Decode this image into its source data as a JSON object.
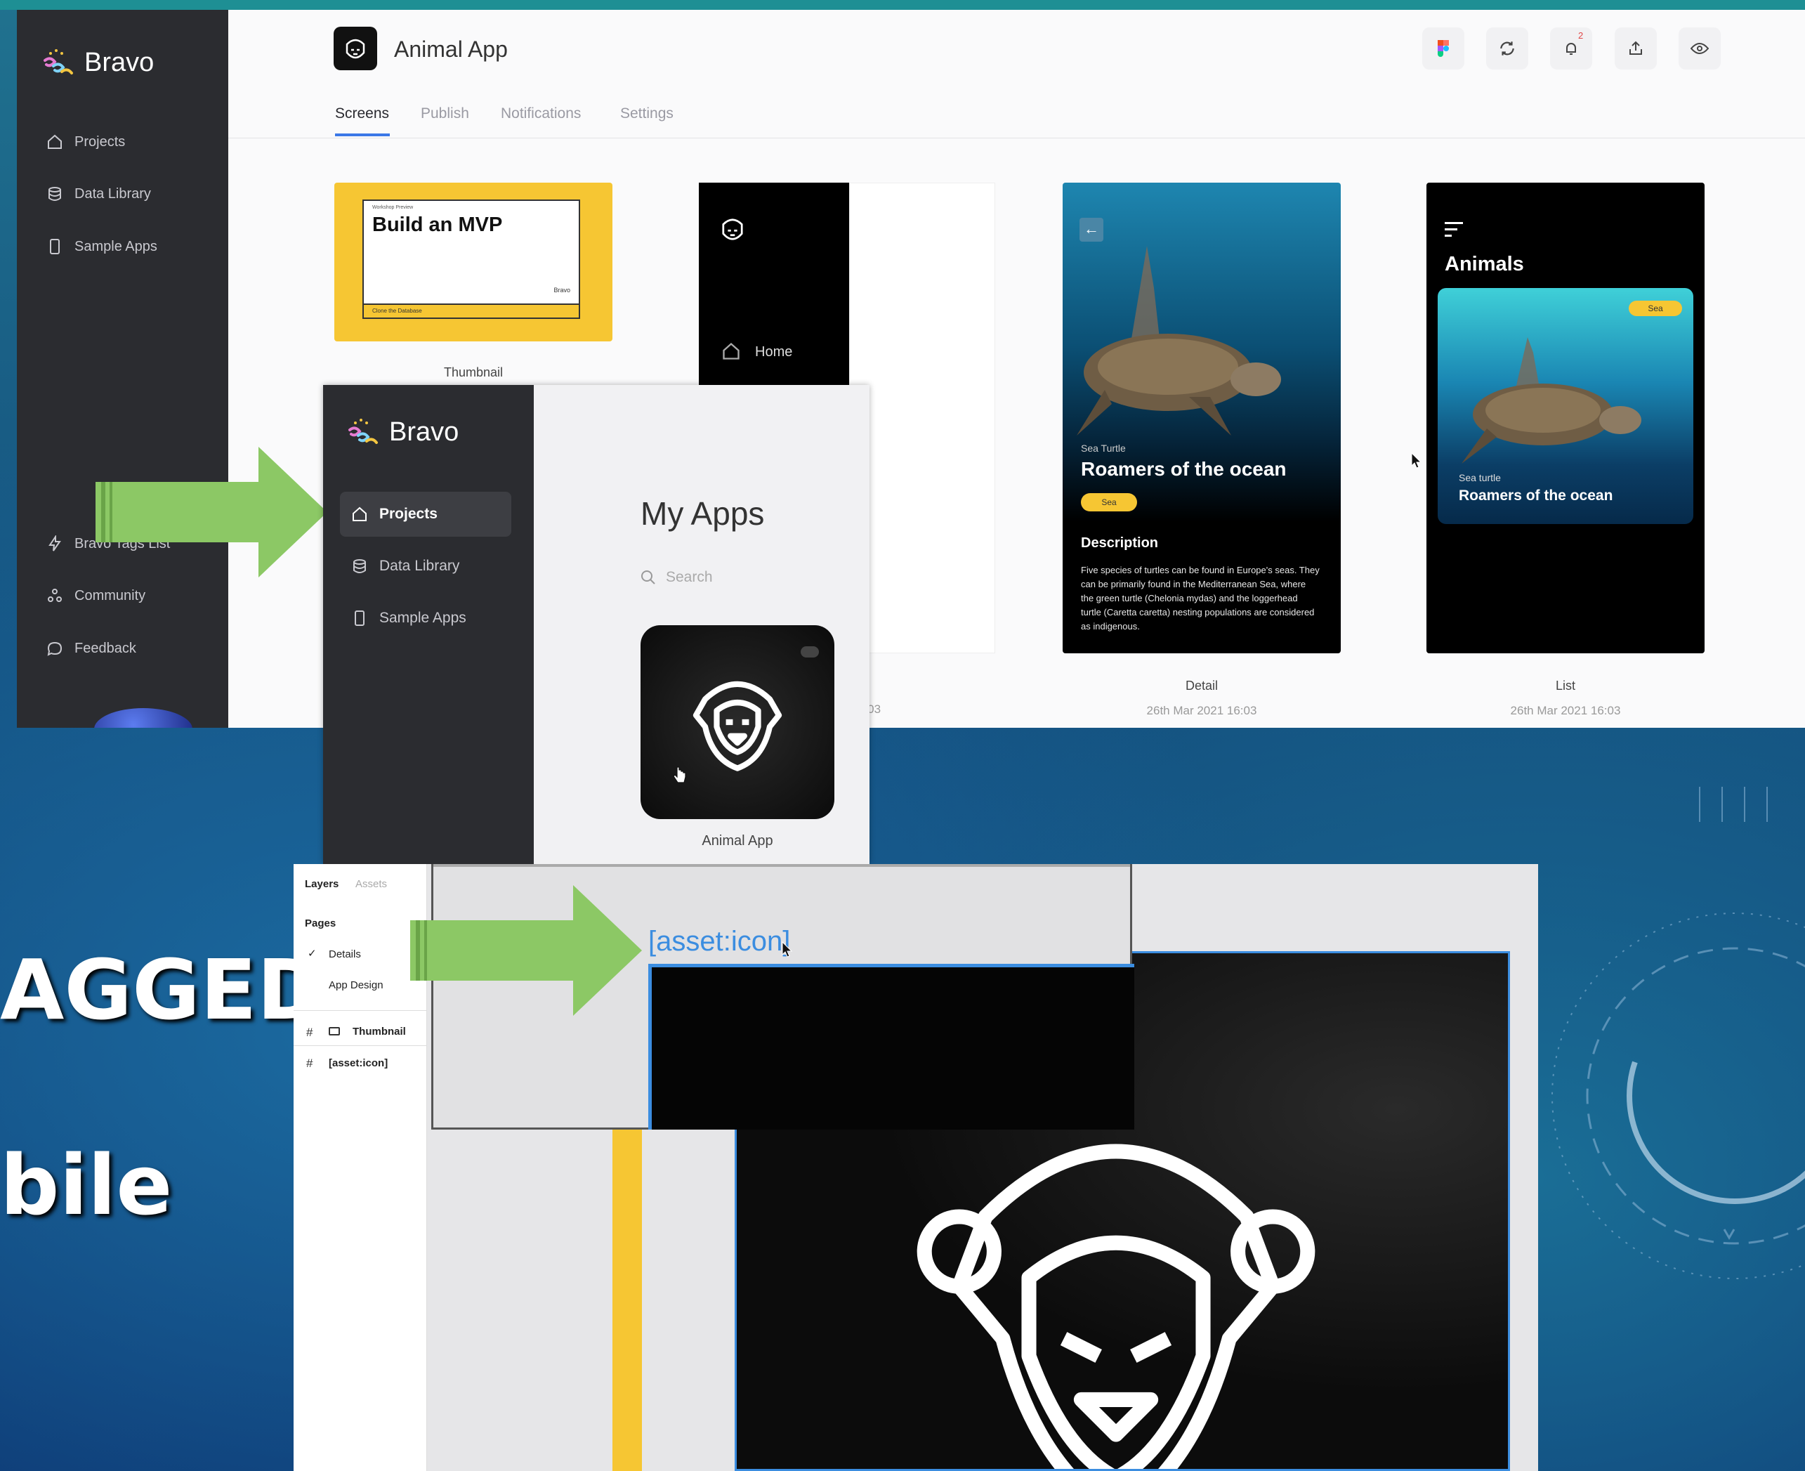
{
  "slide": {
    "partial_text_1": "AGGED",
    "partial_text_2": "bile"
  },
  "shot1": {
    "brand": "Bravo",
    "sidebar_items": [
      "Projects",
      "Data Library",
      "Sample Apps"
    ],
    "sidebar_bottom_items": [
      "Bravo Tags List",
      "Community",
      "Feedback"
    ],
    "app_title": "Animal App",
    "tabs": [
      "Screens",
      "Publish",
      "Notifications",
      "Settings"
    ],
    "active_tab": "Screens",
    "notification_count": "2",
    "toolbar_icons": [
      "figma-icon",
      "sync-icon",
      "bell-icon",
      "share-icon",
      "eye-icon"
    ],
    "screens": [
      {
        "name": "Thumbnail",
        "card_title": "Build an MVP",
        "card_small_top": "Workshop Preview",
        "card_small_bottom": "Clone the Database",
        "card_brand": "Bravo"
      },
      {
        "name": "",
        "home_label": "Home",
        "date_fragment": "6:03"
      },
      {
        "name": "Detail",
        "date": "26th Mar 2021 16:03",
        "eyebrow": "Sea Turtle",
        "title": "Roamers of the ocean",
        "tag": "Sea",
        "desc_heading": "Description",
        "desc": "Five species of turtles can be found in Europe's seas. They can be primarily found in the Mediterranean Sea, where the green turtle (Chelonia mydas) and the loggerhead turtle (Caretta caretta) nesting populations are considered as indigenous."
      },
      {
        "name": "List",
        "date": "26th Mar 2021 16:03",
        "heading": "Animals",
        "tag": "Sea",
        "eyebrow": "Sea turtle",
        "title": "Roamers of the ocean"
      }
    ]
  },
  "shot2": {
    "brand": "Bravo",
    "sidebar_items": [
      "Projects",
      "Data Library",
      "Sample Apps"
    ],
    "active_item": "Projects",
    "heading": "My Apps",
    "search_placeholder": "Search",
    "app_name": "Animal App"
  },
  "shot3": {
    "tabs": [
      "Layers",
      "Assets"
    ],
    "pages_heading": "Pages",
    "pages": [
      "Details",
      "App Design"
    ],
    "checked_page": "Details",
    "layers": [
      "Thumbnail",
      "[asset:icon]"
    ],
    "asset_label": "[asset:icon]"
  },
  "colors": {
    "sidebar": "#2b2c30",
    "arrow": "#8cc865",
    "accent_yellow": "#f6c633",
    "selection_blue": "#3b8de0"
  }
}
